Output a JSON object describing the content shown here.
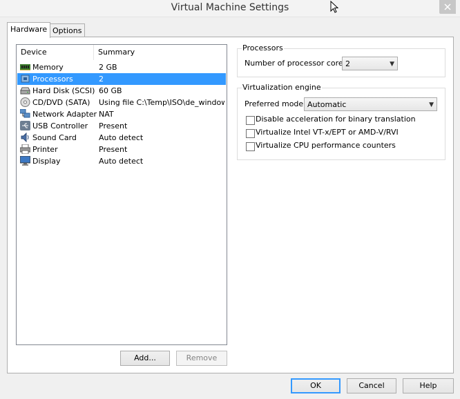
{
  "window": {
    "title": "Virtual Machine Settings"
  },
  "tabs": [
    {
      "label": "Hardware"
    },
    {
      "label": "Options"
    }
  ],
  "device_list": {
    "columns": [
      "Device",
      "Summary"
    ],
    "rows": [
      {
        "device": "Memory",
        "summary": "2 GB",
        "icon": "memory-icon"
      },
      {
        "device": "Processors",
        "summary": "2",
        "icon": "processor-icon",
        "selected": true
      },
      {
        "device": "Hard Disk (SCSI)",
        "summary": "60 GB",
        "icon": "hard-disk-icon"
      },
      {
        "device": "CD/DVD (SATA)",
        "summary": "Using file C:\\Temp\\ISO\\de_window...",
        "icon": "cd-dvd-icon"
      },
      {
        "device": "Network Adapter",
        "summary": "NAT",
        "icon": "network-adapter-icon"
      },
      {
        "device": "USB Controller",
        "summary": "Present",
        "icon": "usb-icon"
      },
      {
        "device": "Sound Card",
        "summary": "Auto detect",
        "icon": "sound-card-icon"
      },
      {
        "device": "Printer",
        "summary": "Present",
        "icon": "printer-icon"
      },
      {
        "device": "Display",
        "summary": "Auto detect",
        "icon": "display-icon"
      }
    ]
  },
  "list_buttons": {
    "add": "Add...",
    "remove": "Remove"
  },
  "processors": {
    "group_title": "Processors",
    "cores_label": "Number of processor cores:",
    "cores_value": "2"
  },
  "virtualization": {
    "group_title": "Virtualization engine",
    "mode_label": "Preferred mode:",
    "mode_value": "Automatic",
    "options": [
      {
        "label": "Disable acceleration for binary translation",
        "checked": false
      },
      {
        "label": "Virtualize Intel VT-x/EPT or AMD-V/RVI",
        "checked": false
      },
      {
        "label": "Virtualize CPU performance counters",
        "checked": false
      }
    ]
  },
  "footer": {
    "ok": "OK",
    "cancel": "Cancel",
    "help": "Help"
  },
  "colors": {
    "selection": "#3399ff",
    "background": "#f0f0f0"
  }
}
